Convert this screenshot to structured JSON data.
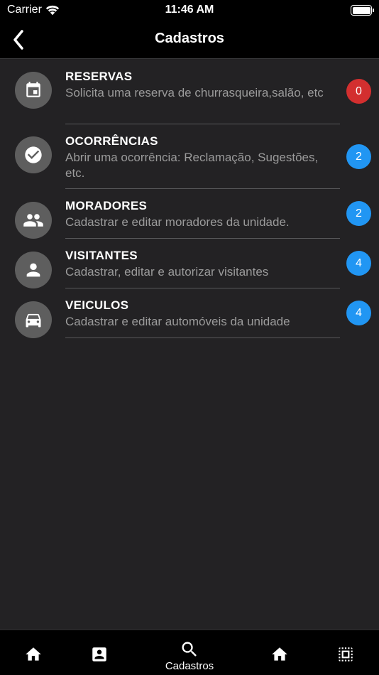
{
  "status": {
    "carrier": "Carrier",
    "time": "11:46 AM"
  },
  "nav": {
    "title": "Cadastros"
  },
  "items": [
    {
      "title": "RESERVAS",
      "description": "Solicita uma reserva de churrasqueira,salão, etc",
      "badge": "0",
      "badge_color": "#d32f2f",
      "icon": "calendar-icon"
    },
    {
      "title": "OCORRÊNCIAS",
      "description": "Abrir uma ocorrência: Reclamação, Sugestões, etc.",
      "badge": "2",
      "badge_color": "#2196f3",
      "icon": "check-circle-icon"
    },
    {
      "title": "MORADORES",
      "description": "Cadastrar e editar moradores da unidade.",
      "badge": "2",
      "badge_color": "#2196f3",
      "icon": "people-icon"
    },
    {
      "title": "VISITANTES",
      "description": "Cadastrar, editar e autorizar visitantes",
      "badge": "4",
      "badge_color": "#2196f3",
      "icon": "person-icon"
    },
    {
      "title": "VEICULOS",
      "description": "Cadastrar e editar automóveis da unidade",
      "badge": "4",
      "badge_color": "#2196f3",
      "icon": "car-icon"
    }
  ],
  "tabbar": {
    "tabs": [
      {
        "icon": "home-icon",
        "label": ""
      },
      {
        "icon": "contact-card-icon",
        "label": ""
      },
      {
        "icon": "search-icon",
        "label": "Cadastros",
        "active": true
      },
      {
        "icon": "home-icon",
        "label": ""
      },
      {
        "icon": "select-all-icon",
        "label": ""
      }
    ]
  }
}
